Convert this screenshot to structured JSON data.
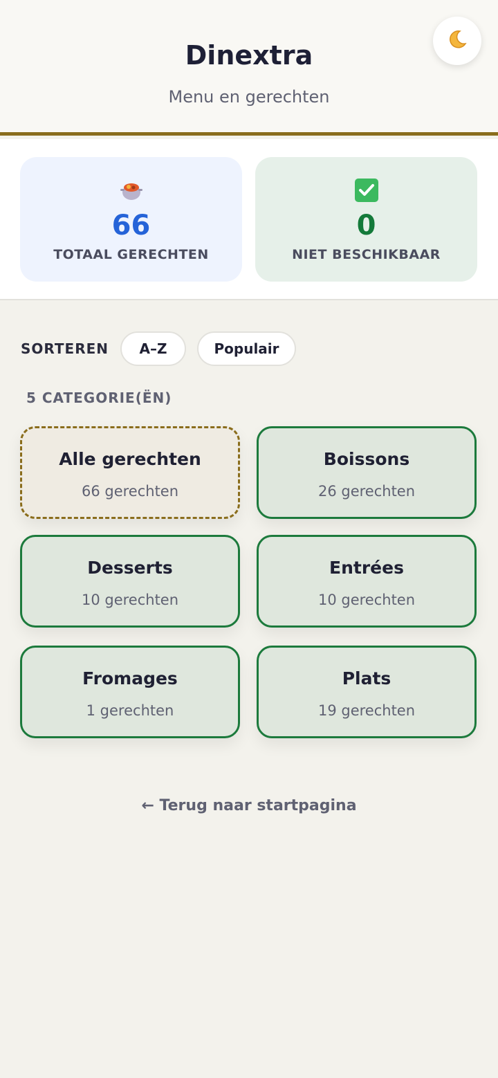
{
  "header": {
    "title": "Dinextra",
    "subtitle": "Menu en gerechten",
    "theme_toggle_icon": "moon-icon"
  },
  "stats": {
    "total": {
      "icon": "pot-of-food-icon",
      "value": "66",
      "label": "TOTAAL GERECHTEN",
      "color": "#2563d8"
    },
    "unavailable": {
      "icon": "check-box-icon",
      "value": "0",
      "label": "NIET BESCHIKBAAR",
      "color": "#147a3a"
    }
  },
  "sort": {
    "label": "SORTEREN",
    "options": [
      "A–Z",
      "Populair"
    ]
  },
  "categories_count": "5 CATEGORIE(ËN)",
  "categories": [
    {
      "name": "Alle gerechten",
      "count": "66 gerechten",
      "selected": true
    },
    {
      "name": "Boissons",
      "count": "26 gerechten"
    },
    {
      "name": "Desserts",
      "count": "10 gerechten"
    },
    {
      "name": "Entrées",
      "count": "10 gerechten"
    },
    {
      "name": "Fromages",
      "count": "1 gerechten"
    },
    {
      "name": "Plats",
      "count": "19 gerechten"
    }
  ],
  "back_link": "← Terug naar startpagina",
  "colors": {
    "accent_gold": "#8a6d1c",
    "category_border": "#1c7a3c",
    "background": "#f3f2ec"
  }
}
